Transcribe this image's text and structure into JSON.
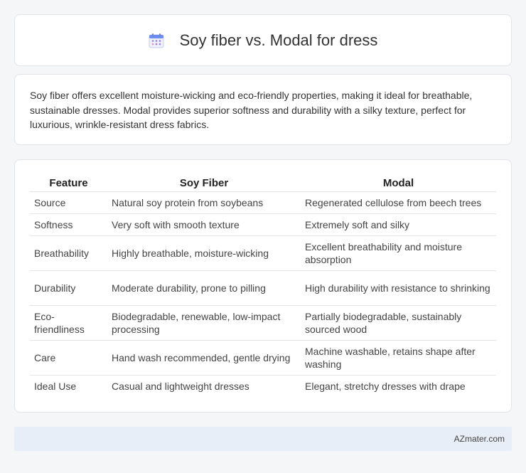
{
  "header": {
    "icon": "calendar-icon",
    "title": "Soy fiber vs. Modal for dress"
  },
  "summary": {
    "text": "Soy fiber offers excellent moisture-wicking and eco-friendly properties, making it ideal for breathable, sustainable dresses. Modal provides superior softness and durability with a silky texture, perfect for luxurious, wrinkle-resistant dress fabrics."
  },
  "table": {
    "headers": [
      "Feature",
      "Soy Fiber",
      "Modal"
    ],
    "rows": [
      [
        "Source",
        "Natural soy protein from soybeans",
        "Regenerated cellulose from beech trees"
      ],
      [
        "Softness",
        "Very soft with smooth texture",
        "Extremely soft and silky"
      ],
      [
        "Breathability",
        "Highly breathable, moisture-wicking",
        "Excellent breathability and moisture absorption"
      ],
      [
        "Durability",
        "Moderate durability, prone to pilling",
        "High durability with resistance to shrinking"
      ],
      [
        "Eco-friendliness",
        "Biodegradable, renewable, low-impact processing",
        "Partially biodegradable, sustainably sourced wood"
      ],
      [
        "Care",
        "Hand wash recommended, gentle drying",
        "Machine washable, retains shape after washing"
      ],
      [
        "Ideal Use",
        "Casual and lightweight dresses",
        "Elegant, stretchy dresses with drape"
      ]
    ]
  },
  "footer": {
    "text": "AZmater.com"
  }
}
